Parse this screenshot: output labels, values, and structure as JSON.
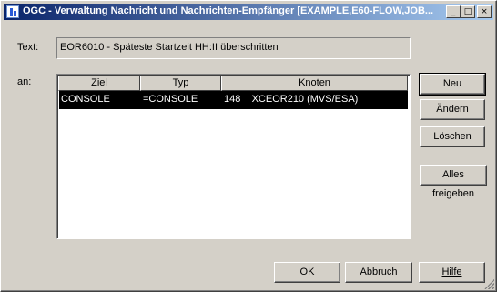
{
  "window": {
    "title": "OGC - Verwaltung Nachricht und Nachrichten-Empfänger [EXAMPLE,E60-FLOW,JOB...",
    "minimize_glyph": "_",
    "maximize_glyph": "□",
    "close_glyph": "×"
  },
  "form": {
    "text_label": "Text:",
    "text_value": "EOR6010 - Späteste Startzeit HH:II überschritten",
    "an_label": "an:"
  },
  "table": {
    "columns": [
      "Ziel",
      "Typ",
      "Knoten"
    ],
    "rows": [
      {
        "ziel": "CONSOLE",
        "typ": "=CONSOLE",
        "knoten": "148    XCEOR210 (MVS/ESA)"
      }
    ]
  },
  "side_buttons": {
    "neu": "Neu",
    "aendern": "Ändern",
    "loeschen": "Löschen",
    "alles_freigeben": "Alles freigeben"
  },
  "bottom_buttons": {
    "ok": "OK",
    "abbruch": "Abbruch",
    "hilfe": "Hilfe"
  }
}
